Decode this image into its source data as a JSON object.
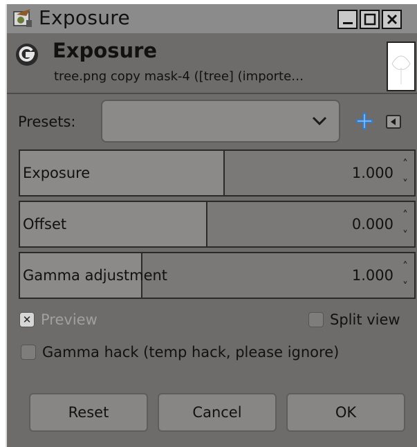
{
  "window": {
    "title": "Exposure"
  },
  "header": {
    "title": "Exposure",
    "subtitle": "tree.png copy mask-4 ([tree] (importe…"
  },
  "presets": {
    "label": "Presets:",
    "selected": ""
  },
  "controls": [
    {
      "label": "Exposure",
      "value": "1.000",
      "fill_fraction": 0.52
    },
    {
      "label": "Offset",
      "value": "0.000",
      "fill_fraction": 0.475
    },
    {
      "label": "Gamma adjustment",
      "value": "1.000",
      "fill_fraction": 0.31
    }
  ],
  "options": {
    "preview": {
      "label": "Preview",
      "checked": true
    },
    "split_view": {
      "label": "Split view",
      "checked": false
    },
    "gamma_hack": {
      "label": "Gamma hack (temp hack, please ignore)",
      "checked": false
    }
  },
  "buttons": {
    "reset": "Reset",
    "cancel": "Cancel",
    "ok": "OK"
  },
  "colors": {
    "add_icon": "#2f7fd6",
    "background": "#6e6b6b"
  }
}
